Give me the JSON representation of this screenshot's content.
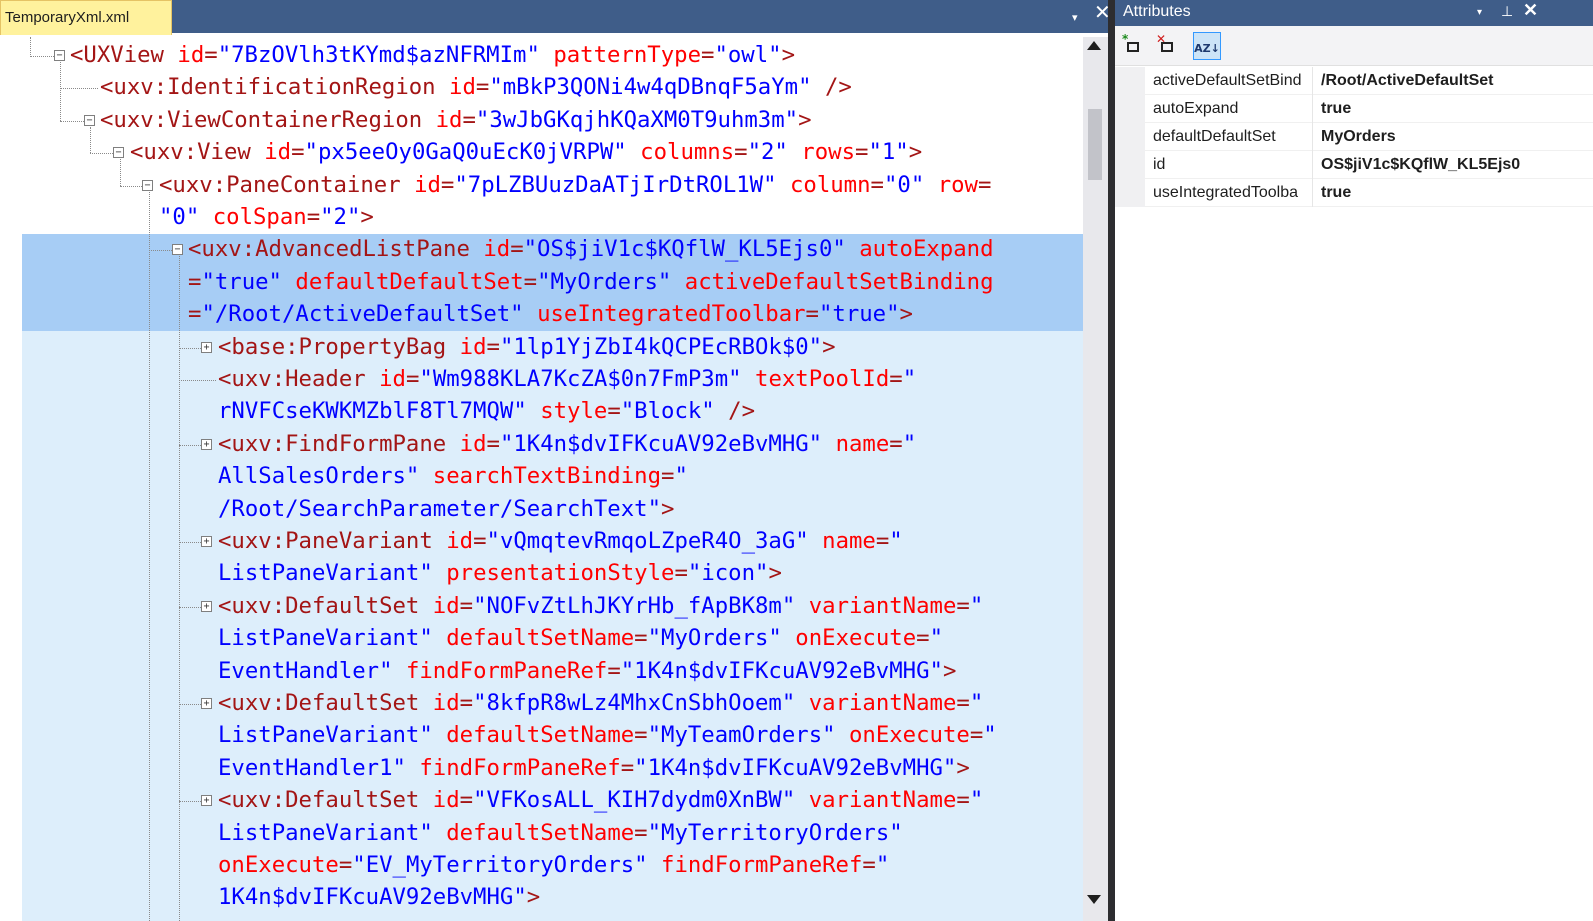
{
  "editor": {
    "tab_label": "TemporaryXml.xml",
    "tab_dropdown_icon": "▾",
    "tab_close_icon": "✕"
  },
  "xml_lines": [
    [
      [
        "tag",
        "<UXView "
      ],
      [
        "attr",
        "id"
      ],
      [
        "tag",
        "="
      ],
      [
        "val",
        "\"7BzOVlh3tKYmd$azNFRMIm\""
      ],
      [
        "tag",
        " "
      ],
      [
        "attr",
        "patternType"
      ],
      [
        "tag",
        "="
      ],
      [
        "val",
        "\"owl\""
      ],
      [
        "tag",
        ">"
      ]
    ],
    [
      [
        "tag",
        "<uxv:IdentificationRegion "
      ],
      [
        "attr",
        "id"
      ],
      [
        "tag",
        "="
      ],
      [
        "val",
        "\"mBkP3QONi4w4qDBnqF5aYm\""
      ],
      [
        "tag",
        " />"
      ]
    ],
    [
      [
        "tag",
        "<uxv:ViewContainerRegion "
      ],
      [
        "attr",
        "id"
      ],
      [
        "tag",
        "="
      ],
      [
        "val",
        "\"3wJbGKqjhKQaXM0T9uhm3m\""
      ],
      [
        "tag",
        ">"
      ]
    ],
    [
      [
        "tag",
        "<uxv:View "
      ],
      [
        "attr",
        "id"
      ],
      [
        "tag",
        "="
      ],
      [
        "val",
        "\"px5eeOy0GaQ0uEcK0jVRPW\""
      ],
      [
        "tag",
        " "
      ],
      [
        "attr",
        "columns"
      ],
      [
        "tag",
        "="
      ],
      [
        "val",
        "\"2\""
      ],
      [
        "tag",
        " "
      ],
      [
        "attr",
        "rows"
      ],
      [
        "tag",
        "="
      ],
      [
        "val",
        "\"1\""
      ],
      [
        "tag",
        ">"
      ]
    ],
    [
      [
        "tag",
        "<uxv:PaneContainer "
      ],
      [
        "attr",
        "id"
      ],
      [
        "tag",
        "="
      ],
      [
        "val",
        "\"7pLZBUuzDaATjIrDtROL1W\""
      ],
      [
        "tag",
        " "
      ],
      [
        "attr",
        "column"
      ],
      [
        "tag",
        "="
      ],
      [
        "val",
        "\"0\""
      ],
      [
        "tag",
        " "
      ],
      [
        "attr",
        "row"
      ],
      [
        "tag",
        "="
      ]
    ],
    [
      [
        "val",
        "\"0\""
      ],
      [
        "tag",
        " "
      ],
      [
        "attr",
        "colSpan"
      ],
      [
        "tag",
        "="
      ],
      [
        "val",
        "\"2\""
      ],
      [
        "tag",
        ">"
      ]
    ],
    [
      [
        "tag",
        "<uxv:AdvancedListPane "
      ],
      [
        "attr",
        "id"
      ],
      [
        "tag",
        "="
      ],
      [
        "val",
        "\"OS$jiV1c$KQflW_KL5Ejs0\""
      ],
      [
        "tag",
        " "
      ],
      [
        "attr",
        "autoExpand"
      ]
    ],
    [
      [
        "tag",
        "="
      ],
      [
        "val",
        "\"true\""
      ],
      [
        "tag",
        " "
      ],
      [
        "attr",
        "defaultDefaultSet"
      ],
      [
        "tag",
        "="
      ],
      [
        "val",
        "\"MyOrders\""
      ],
      [
        "tag",
        " "
      ],
      [
        "attr",
        "activeDefaultSetBinding"
      ]
    ],
    [
      [
        "tag",
        "="
      ],
      [
        "val",
        "\"/Root/ActiveDefaultSet\""
      ],
      [
        "tag",
        " "
      ],
      [
        "attr",
        "useIntegratedToolbar"
      ],
      [
        "tag",
        "="
      ],
      [
        "val",
        "\"true\""
      ],
      [
        "tag",
        ">"
      ]
    ],
    [
      [
        "tag",
        "<base:PropertyBag "
      ],
      [
        "attr",
        "id"
      ],
      [
        "tag",
        "="
      ],
      [
        "val",
        "\"1lp1YjZbI4kQCPEcRBOk$0\""
      ],
      [
        "tag",
        ">"
      ]
    ],
    [
      [
        "tag",
        "<uxv:Header "
      ],
      [
        "attr",
        "id"
      ],
      [
        "tag",
        "="
      ],
      [
        "val",
        "\"Wm988KLA7KcZA$0n7FmP3m\""
      ],
      [
        "tag",
        " "
      ],
      [
        "attr",
        "textPoolId"
      ],
      [
        "tag",
        "="
      ],
      [
        "val",
        "\""
      ]
    ],
    [
      [
        "val",
        "rNVFCseKWKMZblF8Tl7MQW\""
      ],
      [
        "tag",
        " "
      ],
      [
        "attr",
        "style"
      ],
      [
        "tag",
        "="
      ],
      [
        "val",
        "\"Block\""
      ],
      [
        "tag",
        " />"
      ]
    ],
    [
      [
        "tag",
        "<uxv:FindFormPane "
      ],
      [
        "attr",
        "id"
      ],
      [
        "tag",
        "="
      ],
      [
        "val",
        "\"1K4n$dvIFKcuAV92eBvMHG\""
      ],
      [
        "tag",
        " "
      ],
      [
        "attr",
        "name"
      ],
      [
        "tag",
        "="
      ],
      [
        "val",
        "\""
      ]
    ],
    [
      [
        "val",
        "AllSalesOrders\""
      ],
      [
        "tag",
        " "
      ],
      [
        "attr",
        "searchTextBinding"
      ],
      [
        "tag",
        "="
      ],
      [
        "val",
        "\""
      ]
    ],
    [
      [
        "val",
        "/Root/SearchParameter/SearchText\""
      ],
      [
        "tag",
        ">"
      ]
    ],
    [
      [
        "tag",
        "<uxv:PaneVariant "
      ],
      [
        "attr",
        "id"
      ],
      [
        "tag",
        "="
      ],
      [
        "val",
        "\"vQmqtevRmqoLZpeR4O_3aG\""
      ],
      [
        "tag",
        " "
      ],
      [
        "attr",
        "name"
      ],
      [
        "tag",
        "="
      ],
      [
        "val",
        "\""
      ]
    ],
    [
      [
        "val",
        "ListPaneVariant\""
      ],
      [
        "tag",
        " "
      ],
      [
        "attr",
        "presentationStyle"
      ],
      [
        "tag",
        "="
      ],
      [
        "val",
        "\"icon\""
      ],
      [
        "tag",
        ">"
      ]
    ],
    [
      [
        "tag",
        "<uxv:DefaultSet "
      ],
      [
        "attr",
        "id"
      ],
      [
        "tag",
        "="
      ],
      [
        "val",
        "\"NOFvZtLhJKYrHb_fApBK8m\""
      ],
      [
        "tag",
        " "
      ],
      [
        "attr",
        "variantName"
      ],
      [
        "tag",
        "="
      ],
      [
        "val",
        "\""
      ]
    ],
    [
      [
        "val",
        "ListPaneVariant\""
      ],
      [
        "tag",
        " "
      ],
      [
        "attr",
        "defaultSetName"
      ],
      [
        "tag",
        "="
      ],
      [
        "val",
        "\"MyOrders\""
      ],
      [
        "tag",
        " "
      ],
      [
        "attr",
        "onExecute"
      ],
      [
        "tag",
        "="
      ],
      [
        "val",
        "\""
      ]
    ],
    [
      [
        "val",
        "EventHandler\""
      ],
      [
        "tag",
        " "
      ],
      [
        "attr",
        "findFormPaneRef"
      ],
      [
        "tag",
        "="
      ],
      [
        "val",
        "\"1K4n$dvIFKcuAV92eBvMHG\""
      ],
      [
        "tag",
        ">"
      ]
    ],
    [
      [
        "tag",
        "<uxv:DefaultSet "
      ],
      [
        "attr",
        "id"
      ],
      [
        "tag",
        "="
      ],
      [
        "val",
        "\"8kfpR8wLz4MhxCnSbhOoem\""
      ],
      [
        "tag",
        " "
      ],
      [
        "attr",
        "variantName"
      ],
      [
        "tag",
        "="
      ],
      [
        "val",
        "\""
      ]
    ],
    [
      [
        "val",
        "ListPaneVariant\""
      ],
      [
        "tag",
        " "
      ],
      [
        "attr",
        "defaultSetName"
      ],
      [
        "tag",
        "="
      ],
      [
        "val",
        "\"MyTeamOrders\""
      ],
      [
        "tag",
        " "
      ],
      [
        "attr",
        "onExecute"
      ],
      [
        "tag",
        "="
      ],
      [
        "val",
        "\""
      ]
    ],
    [
      [
        "val",
        "EventHandler1\""
      ],
      [
        "tag",
        " "
      ],
      [
        "attr",
        "findFormPaneRef"
      ],
      [
        "tag",
        "="
      ],
      [
        "val",
        "\"1K4n$dvIFKcuAV92eBvMHG\""
      ],
      [
        "tag",
        ">"
      ]
    ],
    [
      [
        "tag",
        "<uxv:DefaultSet "
      ],
      [
        "attr",
        "id"
      ],
      [
        "tag",
        "="
      ],
      [
        "val",
        "\"VFKosALL_KIH7dydm0XnBW\""
      ],
      [
        "tag",
        " "
      ],
      [
        "attr",
        "variantName"
      ],
      [
        "tag",
        "="
      ],
      [
        "val",
        "\""
      ]
    ],
    [
      [
        "val",
        "ListPaneVariant\""
      ],
      [
        "tag",
        " "
      ],
      [
        "attr",
        "defaultSetName"
      ],
      [
        "tag",
        "="
      ],
      [
        "val",
        "\"MyTerritoryOrders\""
      ]
    ],
    [
      [
        "attr",
        "onExecute"
      ],
      [
        "tag",
        "="
      ],
      [
        "val",
        "\"EV_MyTerritoryOrders\""
      ],
      [
        "tag",
        " "
      ],
      [
        "attr",
        "findFormPaneRef"
      ],
      [
        "tag",
        "="
      ],
      [
        "val",
        "\""
      ]
    ],
    [
      [
        "val",
        "1K4n$dvIFKcuAV92eBvMHG\""
      ],
      [
        "tag",
        ">"
      ]
    ]
  ],
  "expanders": [
    "⊟",
    "",
    "⊟",
    "⊟",
    "⊟",
    "",
    "⊟",
    "",
    "",
    "⊞",
    "",
    "",
    "⊞",
    "",
    "",
    "⊞",
    "",
    "⊞",
    "",
    "",
    "⊞",
    "",
    "",
    "⊞",
    "",
    "",
    ""
  ],
  "attributes": {
    "title": "Attributes",
    "dropdown_icon": "▾",
    "pin_icon": "⊥",
    "close_icon": "✕",
    "toolbar": {
      "add_icon": "add-attribute-icon",
      "remove_icon": "remove-attribute-icon",
      "sort_icon": "sort-az-icon",
      "sort_label": "AZ↓"
    },
    "rows": [
      {
        "name": "activeDefaultSetBind",
        "value": "/Root/ActiveDefaultSet"
      },
      {
        "name": "autoExpand",
        "value": "true"
      },
      {
        "name": "defaultDefaultSet",
        "value": "MyOrders"
      },
      {
        "name": "id",
        "value": "OS$jiV1c$KQflW_KL5Ejs0"
      },
      {
        "name": "useIntegratedToolba",
        "value": "true"
      }
    ]
  },
  "colors": {
    "tab_active": "#fff29d",
    "title_bar": "#3f5d89",
    "selection": "#a7cdf5",
    "selection_block": "#ddeefb",
    "xml_tag": "#a31515",
    "xml_attr": "#ff0000",
    "xml_value": "#0000ff"
  }
}
